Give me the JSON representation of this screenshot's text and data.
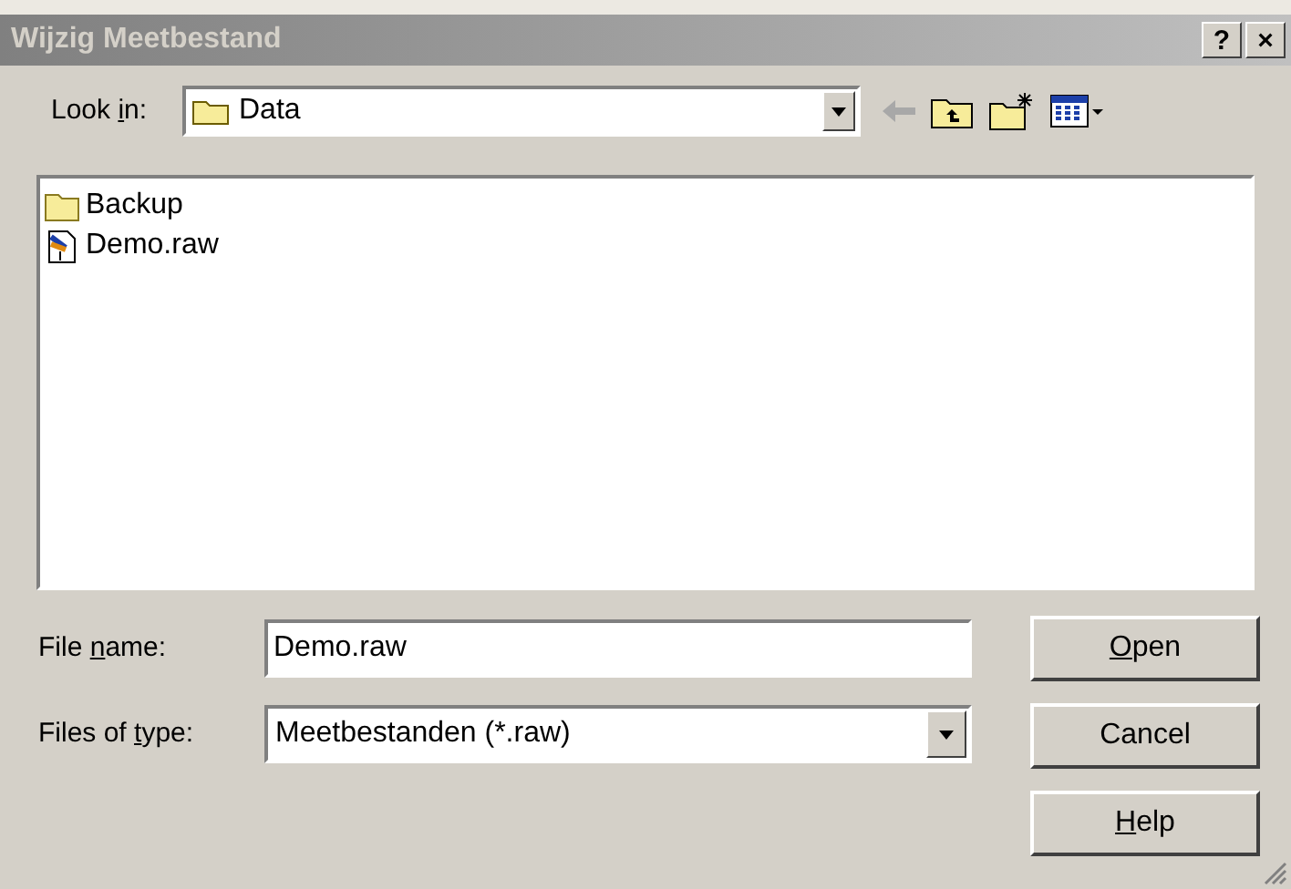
{
  "window": {
    "title": "Wijzig Meetbestand",
    "active": false,
    "title_buttons": [
      "?",
      "×"
    ]
  },
  "look_in": {
    "label_parts": {
      "before": "Look ",
      "key": "i",
      "after": "n:"
    },
    "value": "Data"
  },
  "files": [
    {
      "kind": "folder",
      "name": "Backup"
    },
    {
      "kind": "file",
      "name": "Demo.raw"
    }
  ],
  "file_name": {
    "label_parts": {
      "before": "File ",
      "key": "n",
      "after": "ame:"
    },
    "value": "Demo.raw"
  },
  "file_type": {
    "label_parts": {
      "before": "Files of ",
      "key": "t",
      "after": "ype:"
    },
    "value": "Meetbestanden (*.raw)"
  },
  "buttons": [
    {
      "label_parts": {
        "key": "O",
        "after": "pen"
      }
    },
    {
      "label_parts": {
        "before": "Cancel"
      }
    },
    {
      "label_parts": {
        "key": "H",
        "after": "elp"
      }
    }
  ]
}
